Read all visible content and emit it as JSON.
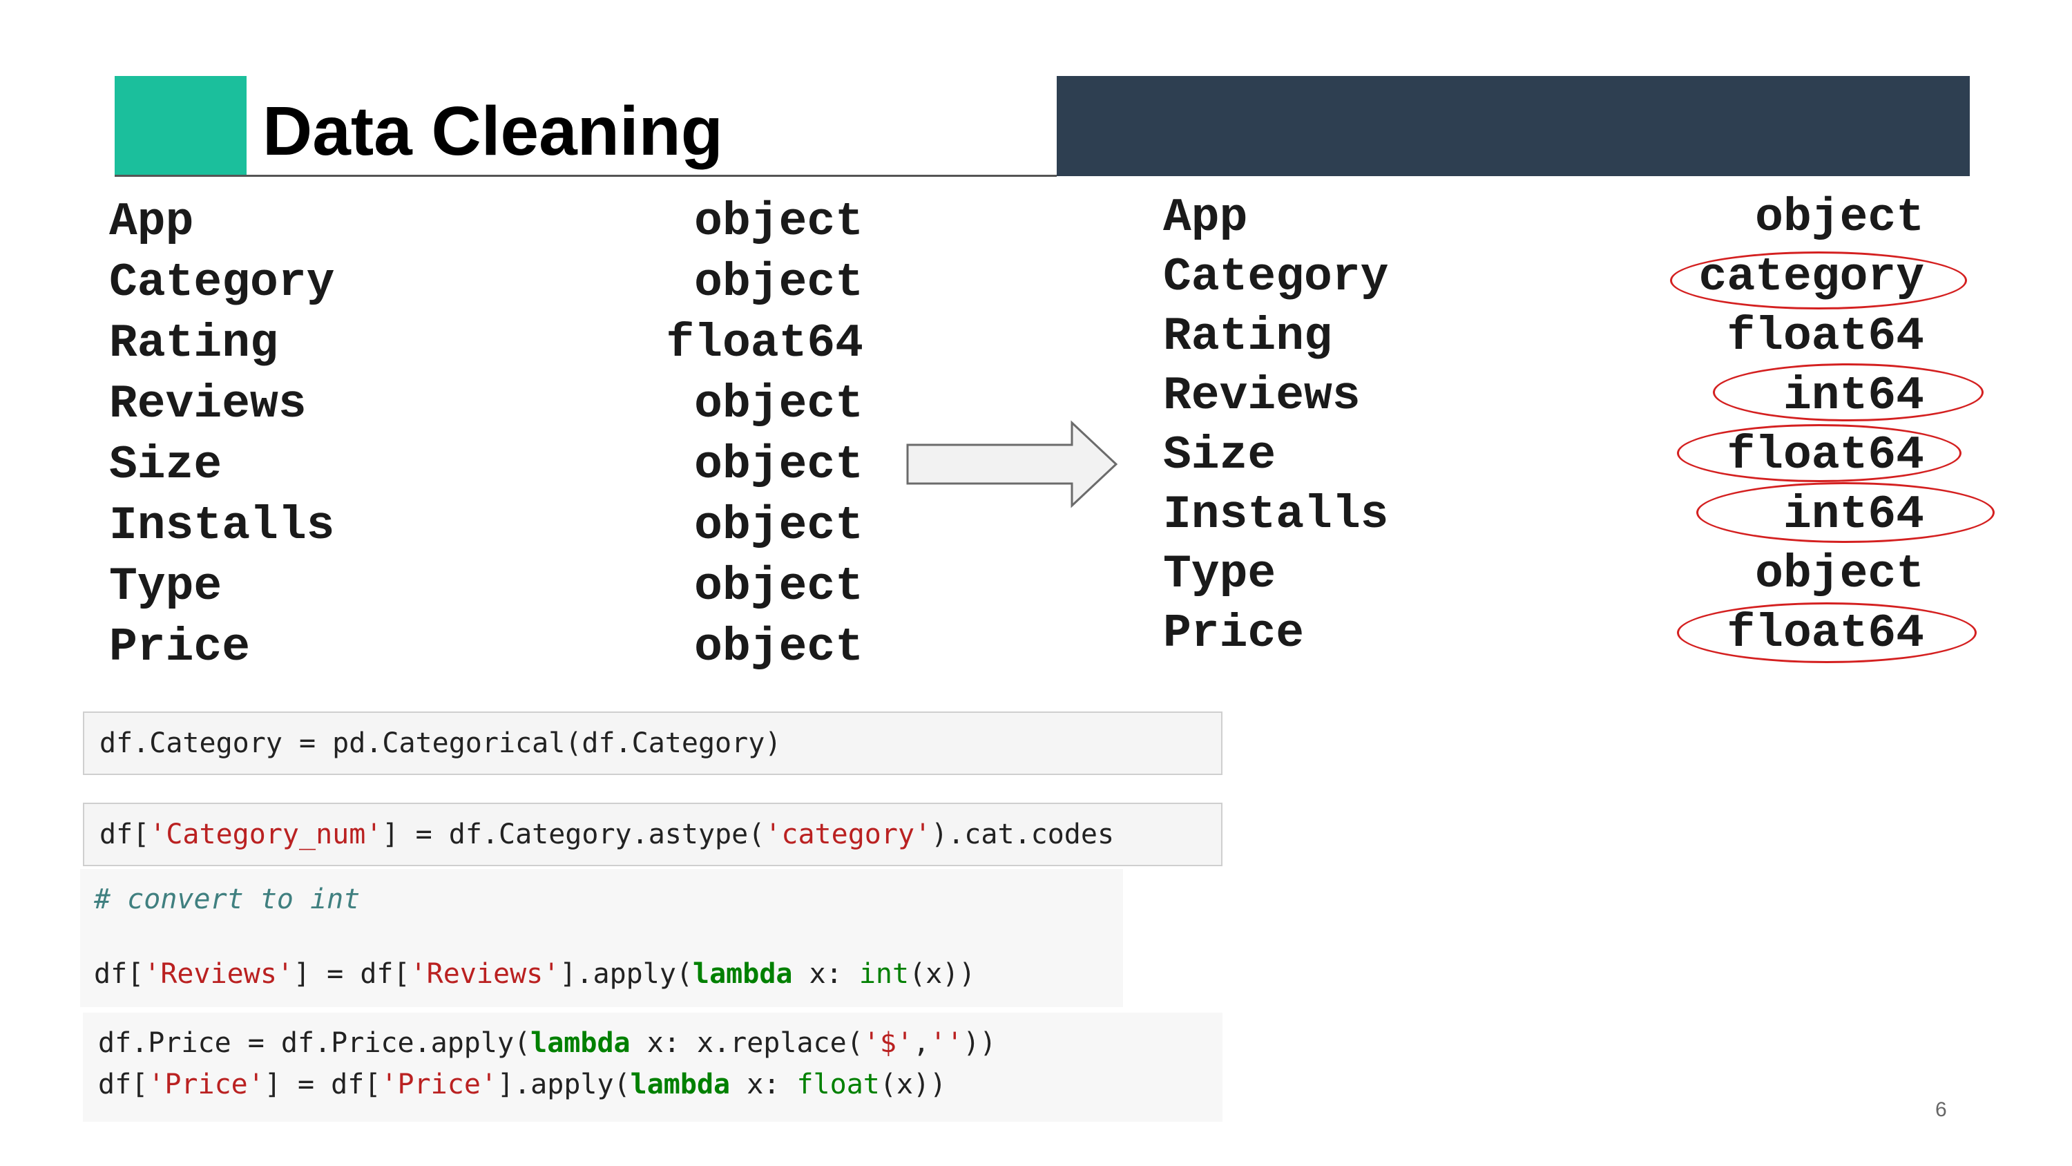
{
  "slide": {
    "title": "Data Cleaning",
    "page_number": "6",
    "colors": {
      "accent": "#1bbf9c",
      "dark_bar": "#2e3f51",
      "highlight_ellipse": "#d42020"
    }
  },
  "dtypes_before": [
    {
      "name": "App",
      "type": "object"
    },
    {
      "name": "Category",
      "type": "object"
    },
    {
      "name": "Rating",
      "type": "float64"
    },
    {
      "name": "Reviews",
      "type": "object"
    },
    {
      "name": "Size",
      "type": "object"
    },
    {
      "name": "Installs",
      "type": "object"
    },
    {
      "name": "Type",
      "type": "object"
    },
    {
      "name": "Price",
      "type": "object"
    }
  ],
  "dtypes_after": [
    {
      "name": "App",
      "type": "object",
      "circled": false
    },
    {
      "name": "Category",
      "type": "category",
      "circled": true
    },
    {
      "name": "Rating",
      "type": "float64",
      "circled": false
    },
    {
      "name": "Reviews",
      "type": "int64",
      "circled": true
    },
    {
      "name": "Size",
      "type": "float64",
      "circled": true
    },
    {
      "name": "Installs",
      "type": "int64",
      "circled": true
    },
    {
      "name": "Type",
      "type": "object",
      "circled": false
    },
    {
      "name": "Price",
      "type": "float64",
      "circled": true
    }
  ],
  "arrow_icon": "right-arrow-icon",
  "code": {
    "cell1": {
      "l1": "df.Category = pd.Categorical(df.Category)"
    },
    "cell2": {
      "a": "df[",
      "b": "'Category_num'",
      "c": "] = df.Category.astype(",
      "d": "'category'",
      "e": ").cat.codes"
    },
    "cell3": {
      "comment": "# convert to int",
      "a": "df[",
      "b": "'Reviews'",
      "c": "] = df[",
      "d": "'Reviews'",
      "e": "].apply(",
      "f": "lambda",
      "g": " x: ",
      "h": "int",
      "i": "(x))"
    },
    "cell4": {
      "l1a": "df.Price = df.Price.apply(",
      "l1b": "lambda",
      "l1c": " x: x.replace(",
      "l1d": "'$'",
      "l1e": ",",
      "l1f": "''",
      "l1g": "))",
      "l2a": "df[",
      "l2b": "'Price'",
      "l2c": "] = df[",
      "l2d": "'Price'",
      "l2e": "].apply(",
      "l2f": "lambda",
      "l2g": " x: ",
      "l2h": "float",
      "l2i": "(x))"
    }
  }
}
